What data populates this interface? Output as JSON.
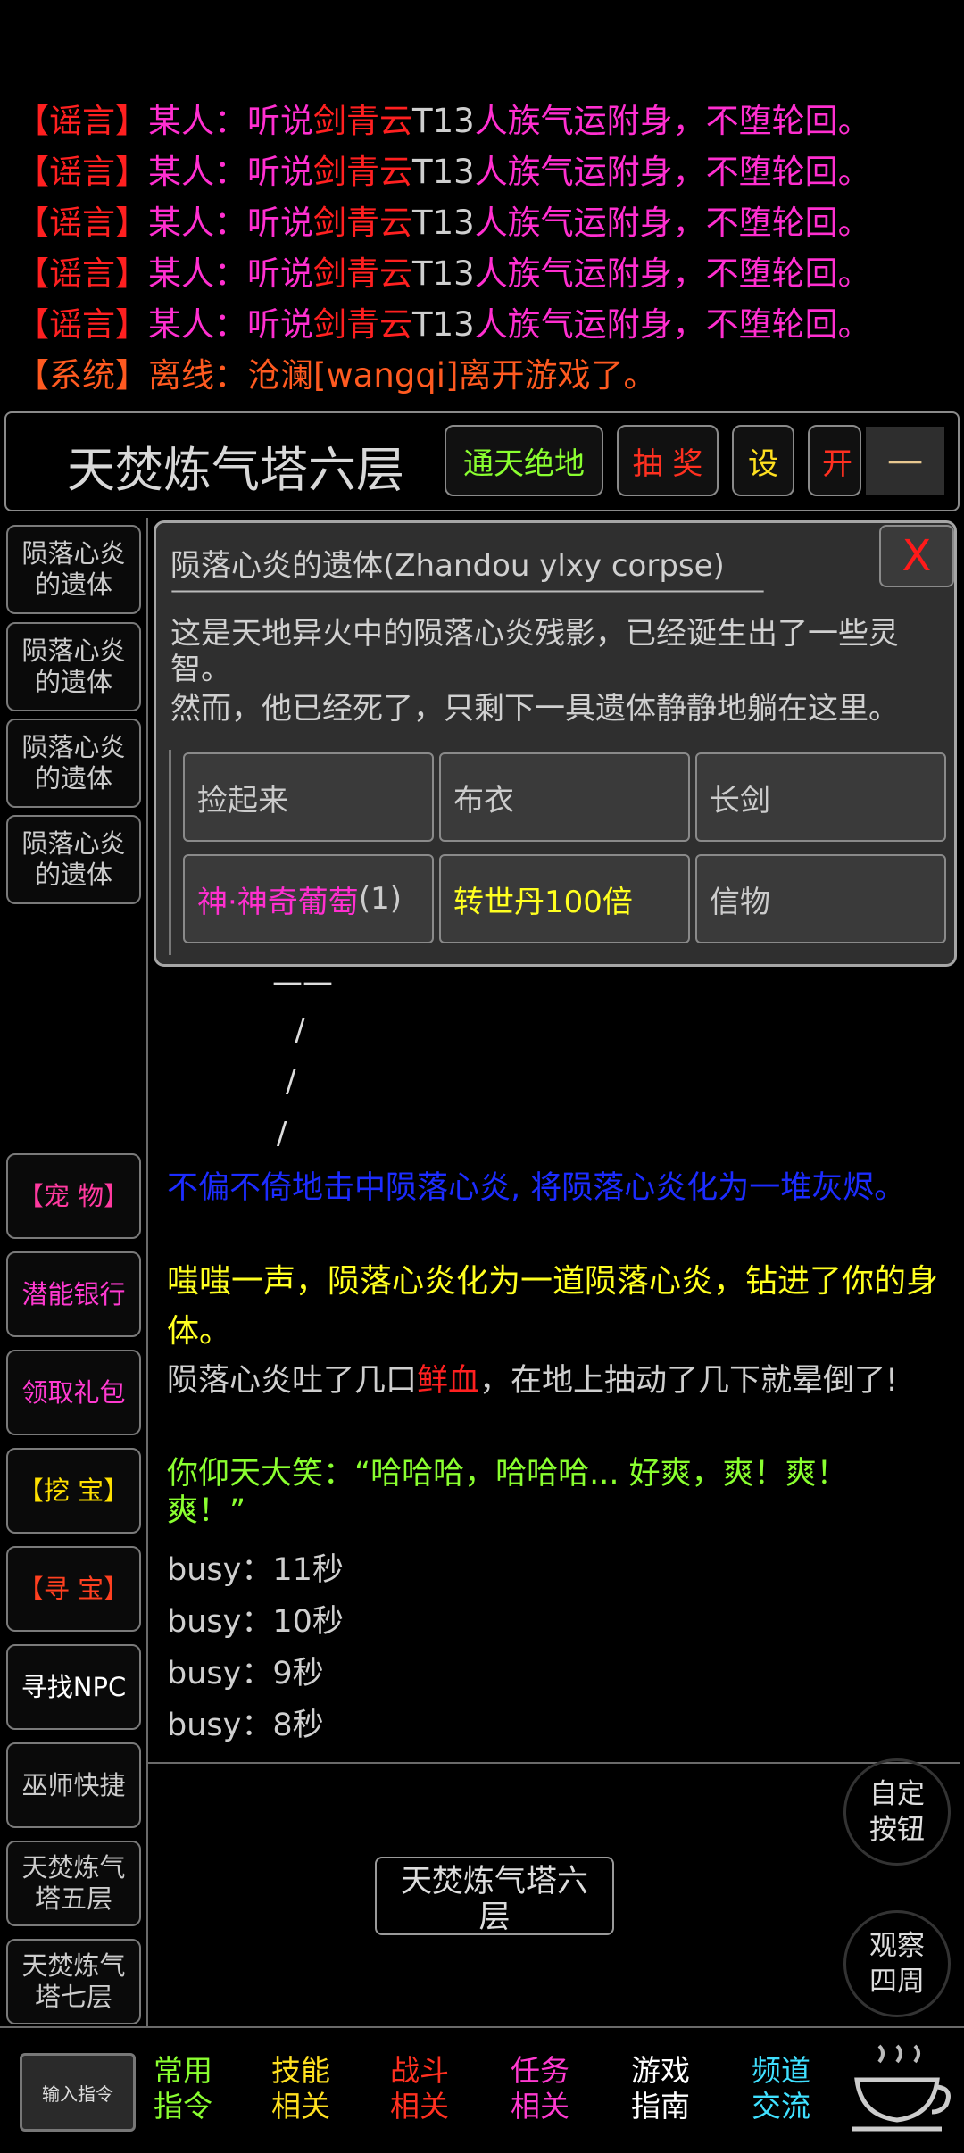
{
  "chat": [
    {
      "tag": "【谣言】",
      "who": "某人：",
      "a": "听说",
      "b": "剑青云",
      "c": "T13",
      "d": "人族气运附身，不堕轮回。"
    },
    {
      "tag": "【谣言】",
      "who": "某人：",
      "a": "听说",
      "b": "剑青云",
      "c": "T13",
      "d": "人族气运附身，不堕轮回。"
    },
    {
      "tag": "【谣言】",
      "who": "某人：",
      "a": "听说",
      "b": "剑青云",
      "c": "T13",
      "d": "人族气运附身，不堕轮回。"
    },
    {
      "tag": "【谣言】",
      "who": "某人：",
      "a": "听说",
      "b": "剑青云",
      "c": "T13",
      "d": "人族气运附身，不堕轮回。"
    },
    {
      "tag": "【谣言】",
      "who": "某人：",
      "a": "听说",
      "b": "剑青云",
      "c": "T13",
      "d": "人族气运附身，不堕轮回。"
    }
  ],
  "system_line": {
    "tag": "【系统】",
    "who": "离线：",
    "text": "沧澜[wangqi]离开游戏了。"
  },
  "header": {
    "location": "天焚炼气塔六层",
    "btn_tongtian": "通天绝地",
    "btn_choujiang": "抽 奖",
    "btn_she": "设",
    "btn_kai": "开",
    "btn_menu": "一"
  },
  "sidebar_top": [
    "陨落心炎\n的遗体",
    "陨落心炎\n的遗体",
    "陨落心炎\n的遗体",
    "陨落心炎\n的遗体"
  ],
  "sidebar_bottom": [
    {
      "label": "【宠 物】",
      "color": "#ff3aa0"
    },
    {
      "label": "潜能银行",
      "color": "#ff3ad0"
    },
    {
      "label": "领取礼包",
      "color": "#ff3ad0"
    },
    {
      "label": "【挖 宝】",
      "color": "#ffe000"
    },
    {
      "label": "【寻 宝】",
      "color": "#ff4020"
    },
    {
      "label": "寻找NPC",
      "color": "#ffffff"
    },
    {
      "label": "巫师快捷",
      "color": "#cccccc"
    },
    {
      "label": "天焚炼气\n塔五层",
      "color": "#cccccc"
    },
    {
      "label": "天焚炼气\n塔七层",
      "color": "#cccccc"
    }
  ],
  "popup": {
    "title": "陨落心炎的遗体(Zhandou ylxy corpse)",
    "close": "X",
    "divider": "——————————————————————————————",
    "desc1": "这是天地异火中的陨落心炎残影，已经诞生出了一些灵智。",
    "desc2": "然而，他已经死了，只剩下一具遗体静静地躺在这里。",
    "actions": [
      {
        "label": "捡起来",
        "color": "#cccccc"
      },
      {
        "label": "布衣",
        "color": "#cccccc"
      },
      {
        "label": "长剑",
        "color": "#cccccc"
      },
      {
        "label": "神·神奇葡萄",
        "suffix": "(1)",
        "color": "#ff2fd0"
      },
      {
        "label": "转世丹100倍",
        "color": "#ffff20"
      },
      {
        "label": "信物",
        "color": "#cccccc"
      }
    ]
  },
  "map_art": [
    "——",
    "/",
    "/",
    "/"
  ],
  "log": {
    "blue": "不偏不倚地击中陨落心炎, 将陨落心炎化为一堆灰烬。",
    "yellow": "嗤嗤一声，陨落心炎化为一道陨落心炎，钻进了你的身体。",
    "gray_a": "陨落心炎吐了几口",
    "gray_red": "鲜血",
    "gray_b": "，在地上抽动了几下就晕倒了!",
    "green": "你仰天大笑：“哈哈哈，哈哈哈... 好爽，爽！爽！爽！”",
    "busy": [
      "busy：11秒",
      "busy：10秒",
      "busy：9秒",
      "busy：8秒"
    ]
  },
  "map_label": "天焚炼气塔六层",
  "round_buttons": [
    "自定\n按钮",
    "观察\n四周"
  ],
  "bottom": {
    "input_label": "输入指令",
    "tabs": [
      {
        "label": "常用\n指令",
        "color": "#8aff30"
      },
      {
        "label": "技能\n相关",
        "color": "#ffe020"
      },
      {
        "label": "战斗\n相关",
        "color": "#ff3020"
      },
      {
        "label": "任务\n相关",
        "color": "#ff3ad0"
      },
      {
        "label": "游戏\n指南",
        "color": "#ffffff"
      },
      {
        "label": "频道\n交流",
        "color": "#40e0ff"
      }
    ]
  }
}
